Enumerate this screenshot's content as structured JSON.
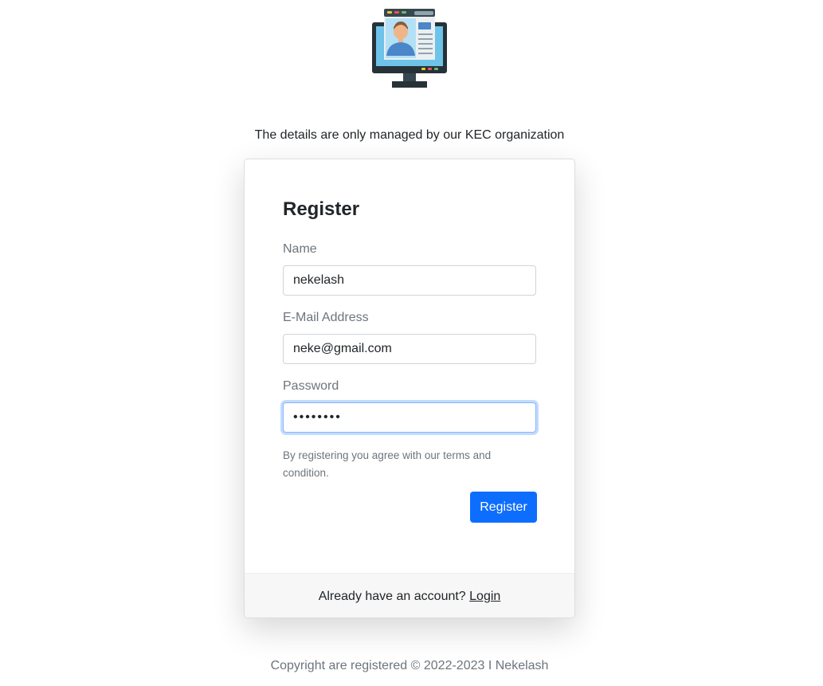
{
  "tagline": "The details are only managed by our KEC organization",
  "form": {
    "title": "Register",
    "name_label": "Name",
    "name_value": "nekelash",
    "email_label": "E-Mail Address",
    "email_value": "neke@gmail.com",
    "password_label": "Password",
    "password_value": "••••••••",
    "hint": "By registering you agree with our terms and condition.",
    "submit_label": "Register"
  },
  "footer": {
    "prompt": "Already have an account?",
    "login_label": "Login"
  },
  "copyright": "Copyright are registered © 2022-2023 I Nekelash",
  "colors": {
    "primary": "#0d6efd",
    "muted": "#6c757d",
    "footer_bg": "#f7f7f7",
    "focus_border": "#86b7fe"
  },
  "icons": {
    "logo": "user-profile-monitor-icon"
  }
}
